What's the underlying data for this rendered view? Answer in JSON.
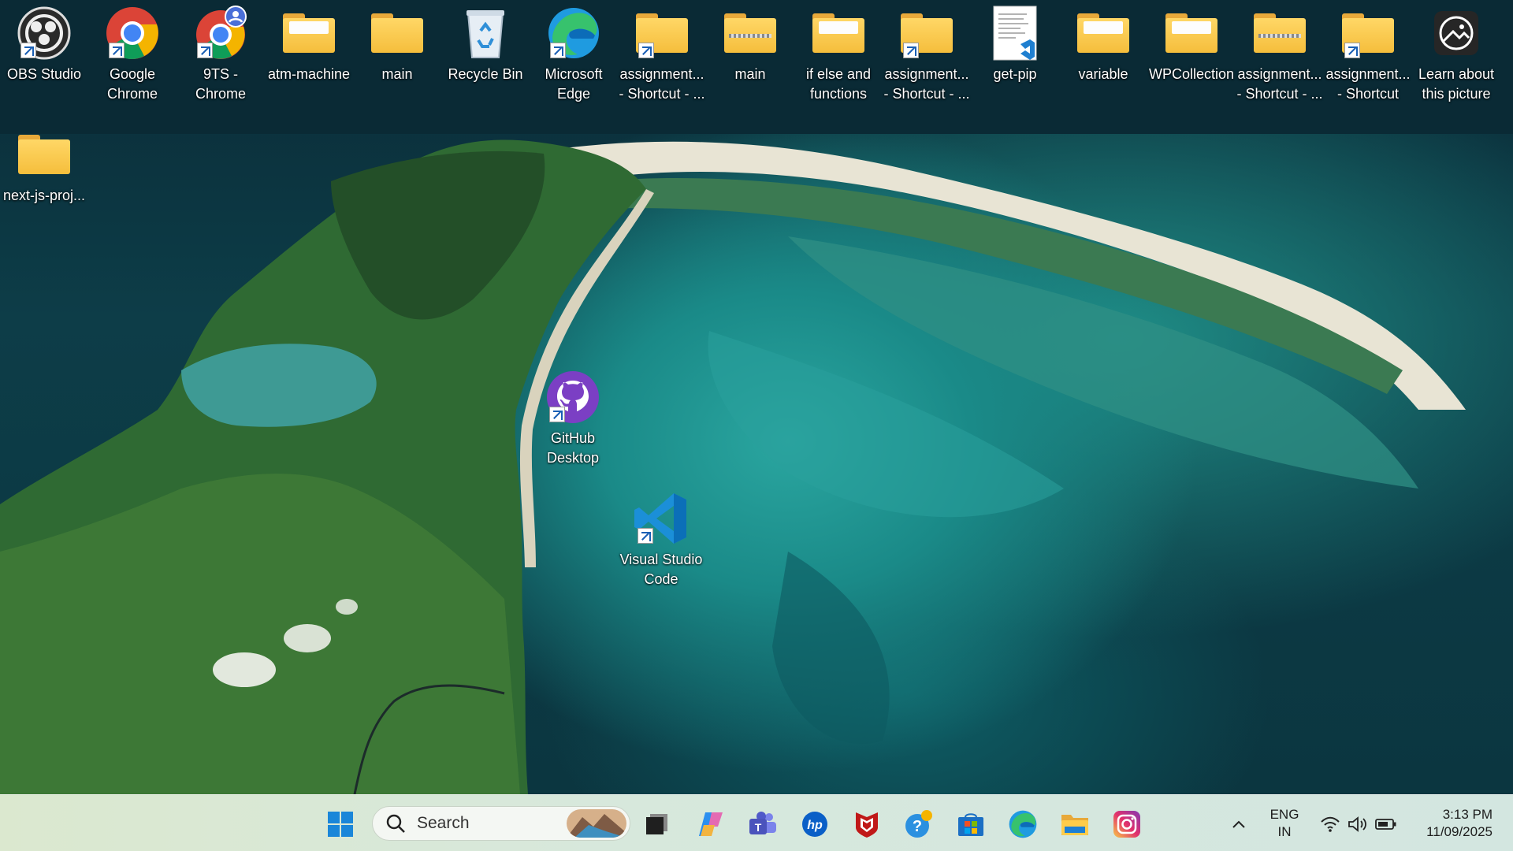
{
  "desktop": {
    "icons": [
      {
        "label": "OBS Studio",
        "icon": "obs-icon"
      },
      {
        "label": "Google Chrome",
        "icon": "chrome-icon"
      },
      {
        "label": "9TS - Chrome",
        "icon": "chrome-profile-icon"
      },
      {
        "label": "atm-machine",
        "icon": "folder-icon"
      },
      {
        "label": "main",
        "icon": "folder-icon"
      },
      {
        "label": "Recycle Bin",
        "icon": "recycle-bin-icon"
      },
      {
        "label": "Microsoft Edge",
        "icon": "edge-icon"
      },
      {
        "label": "assignment... - Shortcut - ...",
        "icon": "folder-shortcut-icon"
      },
      {
        "label": "main",
        "icon": "zip-folder-icon"
      },
      {
        "label": "if else and functions",
        "icon": "folder-icon"
      },
      {
        "label": "assignment... - Shortcut - ...",
        "icon": "folder-shortcut-icon"
      },
      {
        "label": "get-pip",
        "icon": "python-file-icon"
      },
      {
        "label": "variable",
        "icon": "folder-icon"
      },
      {
        "label": "WPCollection",
        "icon": "folder-icon"
      },
      {
        "label": "assignment... - Shortcut - ...",
        "icon": "zip-folder-icon"
      },
      {
        "label": "assignment... - Shortcut",
        "icon": "folder-shortcut-icon"
      },
      {
        "label": "Learn about this picture",
        "icon": "spotlight-icon"
      },
      {
        "label": "next-js-proj...",
        "icon": "folder-icon"
      },
      {
        "label": "GitHub Desktop",
        "icon": "github-icon"
      },
      {
        "label": "Visual Studio Code",
        "icon": "vscode-icon"
      }
    ]
  },
  "taskbar": {
    "search_placeholder": "Search",
    "apps": [
      "start-icon",
      "task-view-icon",
      "copilot-icon",
      "teams-icon",
      "hp-icon",
      "mcafee-icon",
      "get-help-icon",
      "store-icon",
      "edge-icon",
      "file-explorer-icon",
      "instagram-icon"
    ],
    "tray": {
      "language_line1": "ENG",
      "language_line2": "IN",
      "time": "3:13 PM",
      "date": "11/09/2025"
    }
  }
}
